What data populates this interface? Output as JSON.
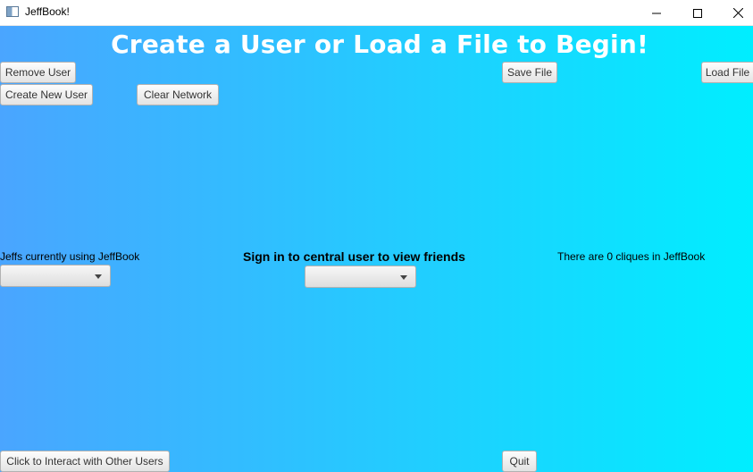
{
  "window": {
    "title": "JeffBook!"
  },
  "header": {
    "headline": "Create a User or Load a File to Begin!"
  },
  "toolbar": {
    "remove_user": "Remove User",
    "create_new_user": "Create New User",
    "clear_network": "Clear Network",
    "save_file": "Save File",
    "load_file": "Load File"
  },
  "left_panel": {
    "label": "Jeffs currently using JeffBook",
    "selected": ""
  },
  "center_panel": {
    "label": "Sign in to central user to view friends",
    "selected": ""
  },
  "right_panel": {
    "label": "There are 0 cliques in JeffBook"
  },
  "footer": {
    "interact": "Click to Interact with Other Users",
    "quit": "Quit"
  },
  "colors": {
    "gradient_start": "#4aa5ff",
    "gradient_end": "#00eeff"
  }
}
